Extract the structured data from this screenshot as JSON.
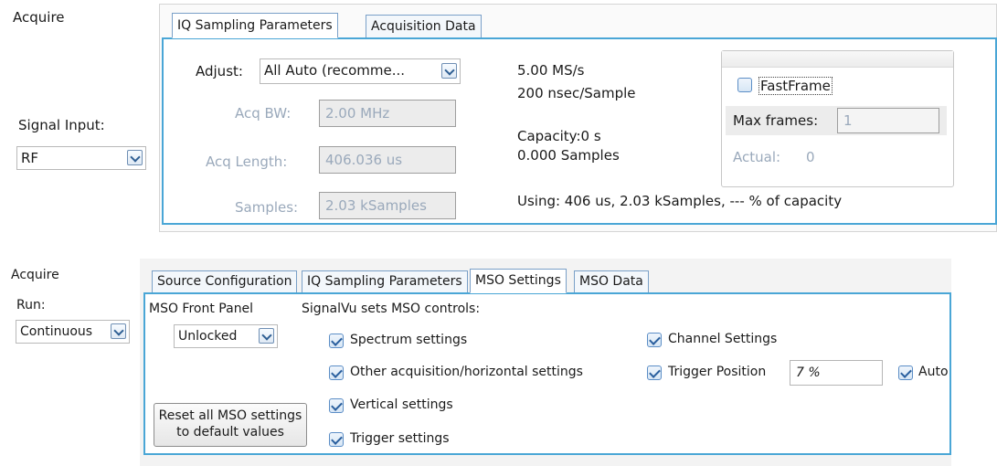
{
  "top": {
    "acquire_label": "Acquire",
    "signal_input": {
      "label": "Signal Input:",
      "value": "RF"
    },
    "tabs": [
      {
        "label": "IQ Sampling Parameters",
        "active": true
      },
      {
        "label": "Acquisition Data",
        "active": false
      }
    ],
    "adjust": {
      "label": "Adjust:",
      "value": "All Auto (recomme..."
    },
    "acq_bw": {
      "label": "Acq BW:",
      "value": "2.00 MHz"
    },
    "acq_length": {
      "label": "Acq Length:",
      "value": "406.036 us"
    },
    "samples": {
      "label": "Samples:",
      "value": "2.03 kSamples"
    },
    "rate": "5.00 MS/s",
    "per_sample": "200 nsec/Sample",
    "capacity": "Capacity:0 s",
    "capacity_samples": "0.000 Samples",
    "using": "Using: 406 us, 2.03 kSamples, --- % of capacity",
    "fastframe": {
      "label": "FastFrame",
      "checked": false,
      "max_frames_label": "Max frames:",
      "max_frames_value": "1",
      "actual_label": "Actual:",
      "actual_value": "0"
    }
  },
  "bottom": {
    "acquire_label": "Acquire",
    "run": {
      "label": "Run:",
      "value": "Continuous"
    },
    "tabs": [
      {
        "label": "Source Configuration",
        "active": false
      },
      {
        "label": "IQ Sampling Parameters",
        "active": false
      },
      {
        "label": "MSO Settings",
        "active": true
      },
      {
        "label": "MSO Data",
        "active": false
      }
    ],
    "front_panel": {
      "label": "MSO Front Panel",
      "value": "Unlocked"
    },
    "sets_label": "SignalVu sets MSO controls:",
    "checks": {
      "spectrum": "Spectrum settings",
      "other_acq": "Other acquisition/horizontal settings",
      "vertical": "Vertical settings",
      "trigger": "Trigger settings",
      "channel": "Channel Settings",
      "trigger_position": "Trigger Position",
      "auto": "Auto"
    },
    "trigger_position_value": "7 %",
    "reset_button": {
      "line1": "Reset all MSO settings",
      "line2": "to default values"
    }
  }
}
